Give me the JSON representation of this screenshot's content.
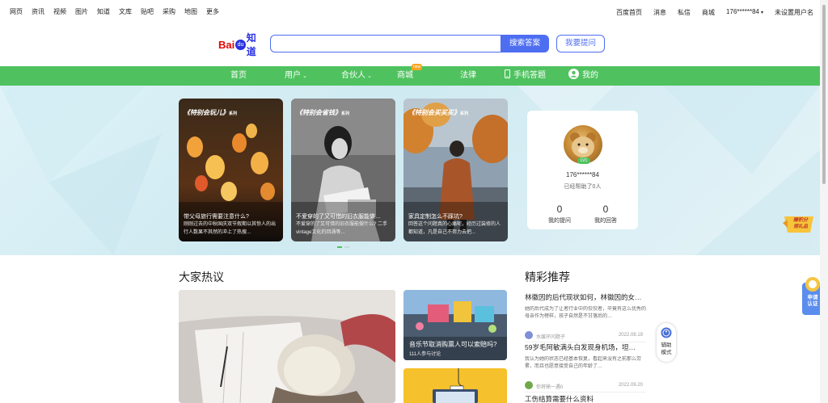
{
  "top_nav": {
    "left": [
      "网页",
      "资讯",
      "视频",
      "图片",
      "知道",
      "文库",
      "贴吧",
      "采购",
      "地图",
      "更多"
    ],
    "right": {
      "home": "百度首页",
      "messages": "消息",
      "private_msg": "私信",
      "mall": "商城",
      "username": "176******84",
      "unset_name": "未设置用户名"
    }
  },
  "logo": {
    "bai": "Bai",
    "du": "du",
    "zhidao": "知道"
  },
  "search": {
    "value": "",
    "button": "搜索答案",
    "ask_button": "我要提问"
  },
  "main_nav": {
    "home": "首页",
    "users": "用户",
    "partners": "合伙人",
    "mall": "商城",
    "mall_badge": "new",
    "law": "法律",
    "mobile": "手机答题",
    "mine": "我的"
  },
  "cards": [
    {
      "tag": "《特别会玩儿》",
      "tag_suffix": "系列",
      "title": "带父母旅行需要注意什么?",
      "desc": "刚刚过去的中秋国庆双节假期以其惊人的出行人数果不其然的冲上了热搜..."
    },
    {
      "tag": "《特别会省钱》",
      "tag_suffix": "系列",
      "title": "不爱穿的了又可惜的旧衣服能做…",
      "desc": "不爱穿的了又可惜的旧衣服能做什么? 二手vintage文化的回涌等..."
    },
    {
      "tag": "《特别会买买买》",
      "tag_suffix": "系列",
      "title": "家具定制怎么不踩坑?",
      "desc": "回答这个问题真的心痛呢，经历过装修的人都知道，凡是自己不努力去把..."
    }
  ],
  "profile": {
    "level": "LV1",
    "name": "176******84",
    "helped": "已经帮助了0人",
    "questions_count": "0",
    "questions_label": "我的提问",
    "answers_count": "0",
    "answers_label": "我的回答"
  },
  "floats": {
    "gift": "赚积分\n领礼品",
    "certify": "申请\n认证",
    "assist": "辅助\n模式"
  },
  "hot": {
    "title": "大家热议",
    "item2_title": "音乐节取消购票人可以索赔吗?",
    "item2_meta": "111人参与讨论"
  },
  "recommend": {
    "title": "精彩推荐",
    "items": [
      {
        "title": "林徽因的后代现状如何，林徽因的女…",
        "desc": "她的后代成为了让者行业中的佼佼者，毕竟有这么优秀的母亲作为榜样，孩子自然是不甘落后的…",
        "user": "水缓环问题子",
        "date": "2022.08.19",
        "avatar_color": "#7f8fd8"
      },
      {
        "title": "59岁毛阿敏满头白发现身机场，坦…",
        "desc": "我认为她的状态已经基本恢复，看起来没有之前那么劳累，而且也愿意接受自己的年龄了…",
        "user": "你将鼎一遇0",
        "date": "2022.09.20",
        "avatar_color": "#6fa84a"
      },
      {
        "title": "工伤结算需要什么资料",
        "desc": "",
        "user": "",
        "date": "",
        "avatar_color": "#cccccc"
      }
    ]
  }
}
